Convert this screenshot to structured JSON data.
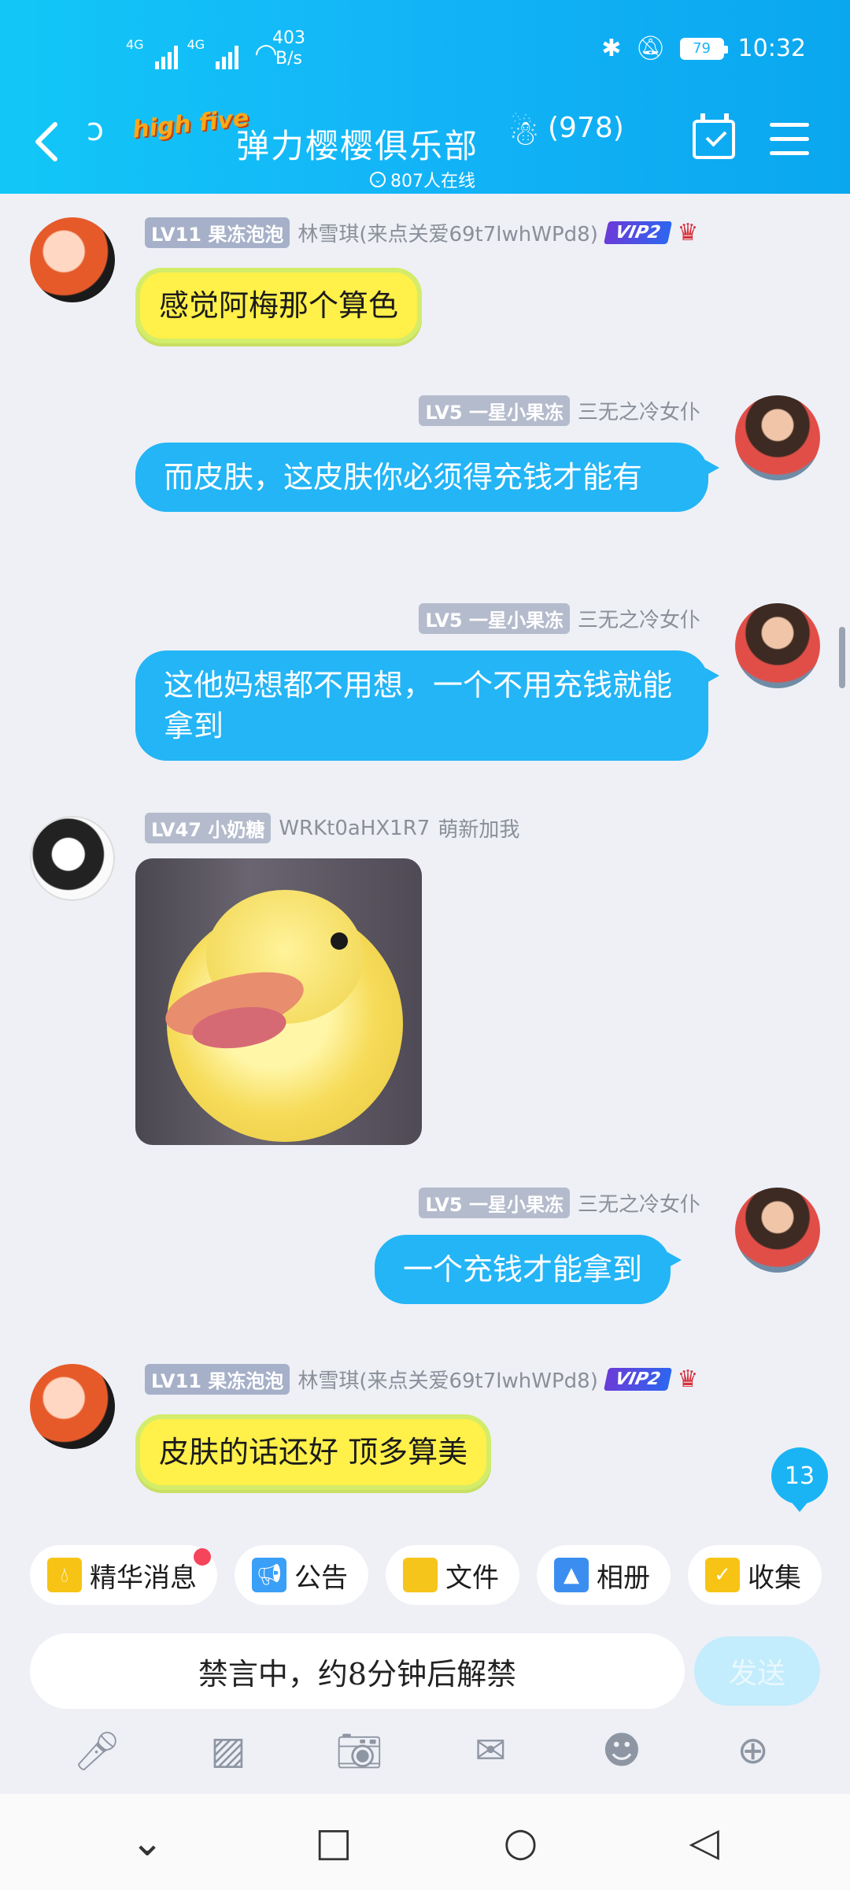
{
  "status": {
    "network_left": "4G",
    "network_right": "4G",
    "speed": "403",
    "speed_unit": "B/s",
    "battery": "79",
    "time": "10:32"
  },
  "header": {
    "logo_text": "high five",
    "title": "弹力樱樱俱乐部",
    "member_count": "(978)",
    "online": "807人在线"
  },
  "messages": [
    {
      "level": "LV11 果冻泡泡",
      "name": "林雪琪(来点关爱69t7lwhWPd8)",
      "vip": "VIP2",
      "text": "感觉阿梅那个算色"
    },
    {
      "level": "LV5 一星小果冻",
      "name": "三无之冷女仆",
      "text": "而皮肤，这皮肤你必须得充钱才能有"
    },
    {
      "level": "LV5 一星小果冻",
      "name": "三无之冷女仆",
      "text": "这他妈想都不用想，一个不用充钱就能拿到"
    },
    {
      "level": "LV47 小奶糖",
      "name": "WRKt0aHX1R7",
      "tag": "萌新加我"
    },
    {
      "level": "LV5 一星小果冻",
      "name": "三无之冷女仆",
      "text": "一个充钱才能拿到"
    },
    {
      "level": "LV11 果冻泡泡",
      "name": "林雪琪(来点关爱69t7lwhWPd8)",
      "vip": "VIP2",
      "text": "皮肤的话还好 顶多算美"
    }
  ],
  "new_count": "13",
  "chips": [
    "精华消息",
    "公告",
    "文件",
    "相册",
    "收集"
  ],
  "input": {
    "placeholder": "禁言中，约8分钟后解禁",
    "send": "发送"
  },
  "colors": {
    "header": "#13b4f7",
    "bubble_blue": "#23b5f6",
    "bubble_yellow": "#fff04a"
  },
  "icons": [
    "mic-icon",
    "image-icon",
    "camera-icon",
    "red-packet-icon",
    "emoji-icon",
    "plus-icon"
  ]
}
